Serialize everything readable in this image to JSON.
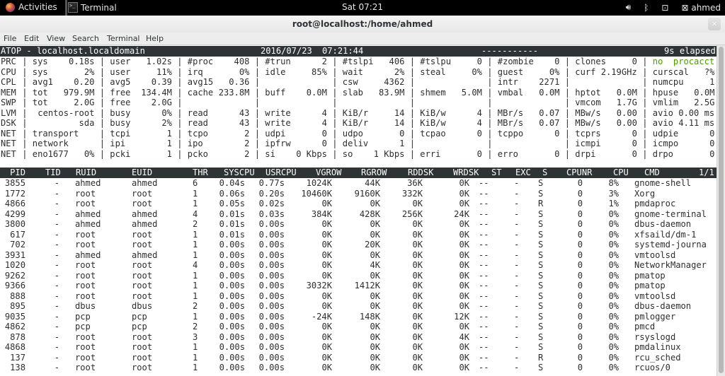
{
  "topbar": {
    "activities": "Activities",
    "app_name": "Terminal",
    "clock": "Sat 07:21",
    "user": "ahmed",
    "icons": [
      "volume-icon",
      "bluetooth-icon",
      "network-icon",
      "user-icon"
    ]
  },
  "window": {
    "title": "root@localhost:/home/ahmed",
    "close": "×"
  },
  "menu": [
    "File",
    "Edit",
    "View",
    "Search",
    "Terminal",
    "Help"
  ],
  "atop": {
    "header": {
      "title": "ATOP - localhost.localdomain",
      "date": "2016/07/23",
      "time": "07:21:44",
      "dashes": "-----------",
      "elapsed": "9s elapsed"
    },
    "sys_lines": [
      {
        "tag": "PRC",
        "cells": [
          [
            "sys",
            "0.18s"
          ],
          [
            "user",
            "1.02s"
          ],
          [
            "#proc",
            "408"
          ],
          [
            "#trun",
            "2"
          ],
          [
            "#tslpi",
            "406"
          ],
          [
            "#tslpu",
            "0"
          ],
          [
            "#zombie",
            "0"
          ],
          [
            "clones",
            "0"
          ],
          [
            "no  procacct",
            ""
          ]
        ]
      },
      {
        "tag": "CPU",
        "cells": [
          [
            "sys",
            "2%"
          ],
          [
            "user",
            "11%"
          ],
          [
            "irq",
            "0%"
          ],
          [
            "idle",
            "85%"
          ],
          [
            "wait",
            "2%"
          ],
          [
            "steal",
            "0%"
          ],
          [
            "guest",
            "0%"
          ],
          [
            "curf 2.19GHz",
            ""
          ],
          [
            "curscal",
            "?%"
          ]
        ]
      },
      {
        "tag": "CPL",
        "cells": [
          [
            "avg1",
            "0.20"
          ],
          [
            "avg5",
            "0.39"
          ],
          [
            "avg15",
            "0.36"
          ],
          [
            "",
            ""
          ],
          [
            "csw",
            "4362"
          ],
          [
            "",
            ""
          ],
          [
            "intr",
            "2271"
          ],
          [
            "",
            ""
          ],
          [
            "numcpu",
            "1"
          ]
        ]
      },
      {
        "tag": "MEM",
        "cells": [
          [
            "tot",
            "979.9M"
          ],
          [
            "free",
            "134.4M"
          ],
          [
            "cache",
            "233.8M"
          ],
          [
            "buff",
            "0.0M"
          ],
          [
            "slab",
            "83.9M"
          ],
          [
            "shmem",
            "5.0M"
          ],
          [
            "vmbal",
            "0.0M"
          ],
          [
            "hptot",
            "0.0M"
          ],
          [
            "hpuse",
            "0.0M"
          ]
        ]
      },
      {
        "tag": "SWP",
        "cells": [
          [
            "tot",
            "2.0G"
          ],
          [
            "free",
            "2.0G"
          ],
          [
            "",
            ""
          ],
          [
            "",
            ""
          ],
          [
            "",
            ""
          ],
          [
            "",
            ""
          ],
          [
            "",
            ""
          ],
          [
            "vmcom",
            "1.7G"
          ],
          [
            "vmlim",
            "2.5G"
          ]
        ]
      },
      {
        "tag": "LVM",
        "cells": [
          [
            "",
            "centos-root"
          ],
          [
            "busy",
            "0%"
          ],
          [
            "read",
            "43"
          ],
          [
            "write",
            "4"
          ],
          [
            "KiB/r",
            "14"
          ],
          [
            "KiB/w",
            "4"
          ],
          [
            "MBr/s",
            "0.07"
          ],
          [
            "MBw/s",
            "0.00"
          ],
          [
            "avio 0.00 ms",
            ""
          ]
        ]
      },
      {
        "tag": "DSK",
        "cells": [
          [
            "",
            "sda"
          ],
          [
            "busy",
            "2%"
          ],
          [
            "read",
            "43"
          ],
          [
            "write",
            "4"
          ],
          [
            "KiB/r",
            "14"
          ],
          [
            "KiB/w",
            "4"
          ],
          [
            "MBr/s",
            "0.07"
          ],
          [
            "MBw/s",
            "0.00"
          ],
          [
            "avio 4.11 ms",
            ""
          ]
        ]
      },
      {
        "tag": "NET",
        "cells": [
          [
            "transport",
            ""
          ],
          [
            "tcpi",
            "1"
          ],
          [
            "tcpo",
            "2"
          ],
          [
            "udpi",
            "0"
          ],
          [
            "udpo",
            "0"
          ],
          [
            "tcpao",
            "0"
          ],
          [
            "tcppo",
            "0"
          ],
          [
            "tcprs",
            "0"
          ],
          [
            "udpie",
            "0"
          ]
        ]
      },
      {
        "tag": "NET",
        "cells": [
          [
            "network",
            ""
          ],
          [
            "ipi",
            "1"
          ],
          [
            "ipo",
            "2"
          ],
          [
            "ipfrw",
            "0"
          ],
          [
            "deliv",
            "1"
          ],
          [
            "",
            ""
          ],
          [
            "",
            ""
          ],
          [
            "icmpi",
            "0"
          ],
          [
            "icmpo",
            "0"
          ]
        ]
      },
      {
        "tag": "NET",
        "cells": [
          [
            "eno1677",
            "0%"
          ],
          [
            "pcki",
            "1"
          ],
          [
            "pcko",
            "2"
          ],
          [
            "si",
            "0 Kbps"
          ],
          [
            "so",
            "1 Kbps"
          ],
          [
            "erri",
            "0"
          ],
          [
            "erro",
            "0"
          ],
          [
            "drpi",
            "0"
          ],
          [
            "drpo",
            "0"
          ]
        ]
      }
    ],
    "proc_columns": [
      "PID",
      "TID",
      "RUID",
      "EUID",
      "THR",
      "SYSCPU",
      "USRCPU",
      "VGROW",
      "RGROW",
      "RDDSK",
      "WRDSK",
      "ST",
      "EXC",
      "S",
      "CPUNR",
      "CPU",
      "CMD",
      "1/1"
    ],
    "processes": [
      [
        "3855",
        "-",
        "ahmed",
        "ahmed",
        "6",
        "0.04s",
        "0.77s",
        "1024K",
        "44K",
        "36K",
        "0K",
        "--",
        "-",
        "S",
        "0",
        "8%",
        "gnome-shell"
      ],
      [
        "1772",
        "-",
        "root",
        "root",
        "1",
        "0.06s",
        "0.20s",
        "10460K",
        "9160K",
        "332K",
        "0K",
        "--",
        "-",
        "S",
        "0",
        "3%",
        "Xorg"
      ],
      [
        "4866",
        "-",
        "root",
        "root",
        "1",
        "0.05s",
        "0.02s",
        "0K",
        "0K",
        "0K",
        "0K",
        "--",
        "-",
        "R",
        "0",
        "1%",
        "pmdaproc"
      ],
      [
        "4299",
        "-",
        "ahmed",
        "ahmed",
        "4",
        "0.01s",
        "0.03s",
        "384K",
        "428K",
        "256K",
        "24K",
        "--",
        "-",
        "S",
        "0",
        "0%",
        "gnome-terminal"
      ],
      [
        "3800",
        "-",
        "ahmed",
        "ahmed",
        "2",
        "0.01s",
        "0.00s",
        "0K",
        "0K",
        "0K",
        "0K",
        "--",
        "-",
        "S",
        "0",
        "0%",
        "dbus-daemon"
      ],
      [
        "617",
        "-",
        "root",
        "root",
        "1",
        "0.01s",
        "0.00s",
        "0K",
        "0K",
        "0K",
        "0K",
        "--",
        "-",
        "S",
        "0",
        "0%",
        "xfsaild/dm-1"
      ],
      [
        "702",
        "-",
        "root",
        "root",
        "1",
        "0.00s",
        "0.00s",
        "0K",
        "20K",
        "0K",
        "0K",
        "--",
        "-",
        "S",
        "0",
        "0%",
        "systemd-journa"
      ],
      [
        "3931",
        "-",
        "ahmed",
        "ahmed",
        "1",
        "0.00s",
        "0.00s",
        "0K",
        "0K",
        "0K",
        "0K",
        "--",
        "-",
        "S",
        "0",
        "0%",
        "vmtoolsd"
      ],
      [
        "1020",
        "-",
        "root",
        "root",
        "4",
        "0.00s",
        "0.00s",
        "0K",
        "4K",
        "0K",
        "0K",
        "--",
        "-",
        "S",
        "0",
        "0%",
        "NetworkManager"
      ],
      [
        "9262",
        "-",
        "root",
        "root",
        "1",
        "0.00s",
        "0.00s",
        "0K",
        "0K",
        "0K",
        "0K",
        "--",
        "-",
        "S",
        "0",
        "0%",
        "pmatop"
      ],
      [
        "9366",
        "-",
        "root",
        "root",
        "1",
        "0.00s",
        "0.00s",
        "3032K",
        "1412K",
        "0K",
        "0K",
        "--",
        "-",
        "S",
        "0",
        "0%",
        "pmatop"
      ],
      [
        "888",
        "-",
        "root",
        "root",
        "1",
        "0.00s",
        "0.00s",
        "0K",
        "0K",
        "0K",
        "0K",
        "--",
        "-",
        "S",
        "0",
        "0%",
        "vmtoolsd"
      ],
      [
        "895",
        "-",
        "dbus",
        "dbus",
        "2",
        "0.00s",
        "0.00s",
        "0K",
        "0K",
        "0K",
        "0K",
        "--",
        "-",
        "S",
        "0",
        "0%",
        "dbus-daemon"
      ],
      [
        "9035",
        "-",
        "pcp",
        "pcp",
        "1",
        "0.00s",
        "0.00s",
        "-24K",
        "148K",
        "0K",
        "12K",
        "--",
        "-",
        "S",
        "0",
        "0%",
        "pmlogger"
      ],
      [
        "4862",
        "-",
        "pcp",
        "pcp",
        "2",
        "0.00s",
        "0.00s",
        "0K",
        "0K",
        "0K",
        "0K",
        "--",
        "-",
        "S",
        "0",
        "0%",
        "pmcd"
      ],
      [
        "878",
        "-",
        "root",
        "root",
        "3",
        "0.00s",
        "0.00s",
        "0K",
        "0K",
        "0K",
        "4K",
        "--",
        "-",
        "S",
        "0",
        "0%",
        "rsyslogd"
      ],
      [
        "4868",
        "-",
        "root",
        "root",
        "1",
        "0.00s",
        "0.00s",
        "0K",
        "0K",
        "0K",
        "0K",
        "--",
        "-",
        "S",
        "0",
        "0%",
        "pmdalinux"
      ],
      [
        "137",
        "-",
        "root",
        "root",
        "1",
        "0.00s",
        "0.00s",
        "0K",
        "0K",
        "0K",
        "0K",
        "--",
        "-",
        "R",
        "0",
        "0%",
        "rcu_sched"
      ],
      [
        "138",
        "-",
        "root",
        "root",
        "1",
        "0.00s",
        "0.00s",
        "0K",
        "0K",
        "0K",
        "0K",
        "--",
        "-",
        "S",
        "0",
        "0%",
        "rcuos/0"
      ]
    ]
  },
  "colors": {
    "header_bg": "#2e3436",
    "procacct_green": "#4e9a06"
  }
}
